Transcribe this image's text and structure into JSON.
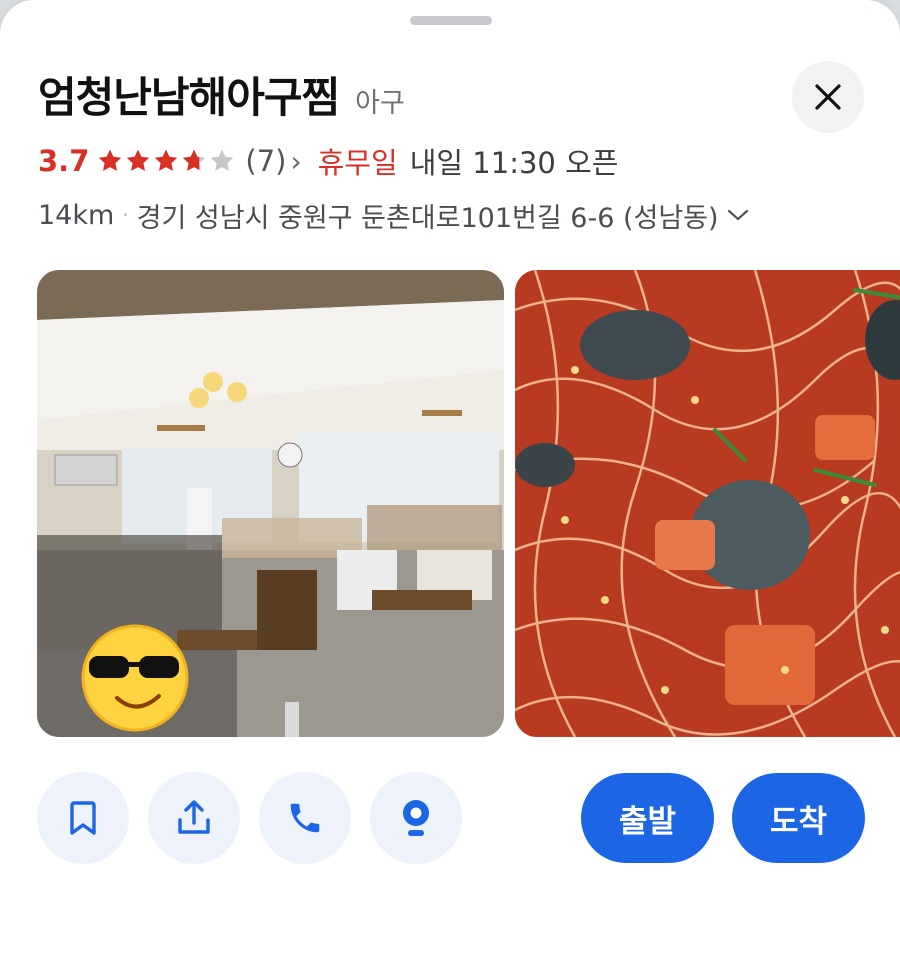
{
  "place": {
    "name": "엄청난남해아구찜",
    "category": "아구"
  },
  "rating": {
    "score": "3.7",
    "stars_value": 3.7,
    "stars_max": 5,
    "review_count": "(7)",
    "status": "휴무일",
    "open_info": "내일 11:30 오픈"
  },
  "address": {
    "distance": "14km",
    "text": "경기 성남시 중원구 둔촌대로101번길 6-6 (성남동)"
  },
  "colors": {
    "accent_red": "#d93025",
    "star_filled": "#d93025",
    "star_empty": "#c4c6c9",
    "primary_blue": "#1c66e5",
    "action_bg": "#eef2fb"
  },
  "photos": [
    {
      "icon": "restaurant-interior-photo"
    },
    {
      "icon": "braised-monkfish-dish-photo"
    }
  ],
  "actions": [
    {
      "icon": "bookmark-icon"
    },
    {
      "icon": "share-icon"
    },
    {
      "icon": "phone-icon"
    },
    {
      "icon": "street-view-icon"
    }
  ],
  "route": {
    "depart_label": "출발",
    "arrive_label": "도착"
  }
}
